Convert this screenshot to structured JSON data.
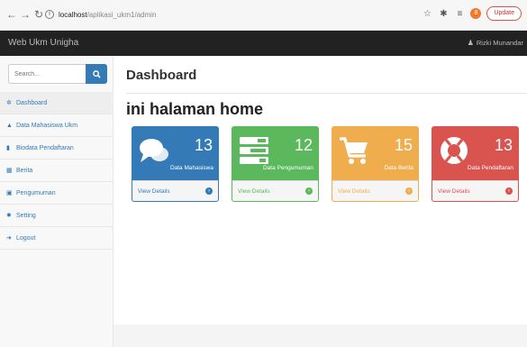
{
  "browser": {
    "url_host": "localhost",
    "url_path": "/aplikasi_ukm1/admin",
    "update_label": "Update",
    "extension_badge": "8"
  },
  "navbar": {
    "brand": "Web Ukm Unigha",
    "user_name": "Rizki Munandar"
  },
  "sidebar": {
    "search_placeholder": "Search...",
    "items": [
      {
        "label": "Dashboard",
        "icon": "dashboard-icon",
        "active": true
      },
      {
        "label": "Data Mahasiswa Ukm",
        "icon": "graduation-cap-icon"
      },
      {
        "label": "Biodata Pendaftaran",
        "icon": "file-icon"
      },
      {
        "label": "Berita",
        "icon": "table-icon"
      },
      {
        "label": "Pengumuman",
        "icon": "image-icon"
      },
      {
        "label": "Setting",
        "icon": "cog-icon"
      },
      {
        "label": "Logout",
        "icon": "sign-out-icon"
      }
    ]
  },
  "main": {
    "title": "Dashboard",
    "welcome": "ini halaman home"
  },
  "panels": [
    {
      "count": "13",
      "label": "Data Mahasiswa",
      "link": "View Details",
      "color": "#337ab7",
      "icon": "comments-icon"
    },
    {
      "count": "12",
      "label": "Data Pengumuman",
      "link": "View Details",
      "color": "#5cb85c",
      "icon": "tasks-icon"
    },
    {
      "count": "15",
      "label": "Data Berita",
      "link": "View Details",
      "color": "#f0ad4e",
      "icon": "shopping-cart-icon"
    },
    {
      "count": "13",
      "label": "Data Pendaftaran",
      "link": "View Details",
      "color": "#d9534f",
      "icon": "support-icon"
    }
  ]
}
